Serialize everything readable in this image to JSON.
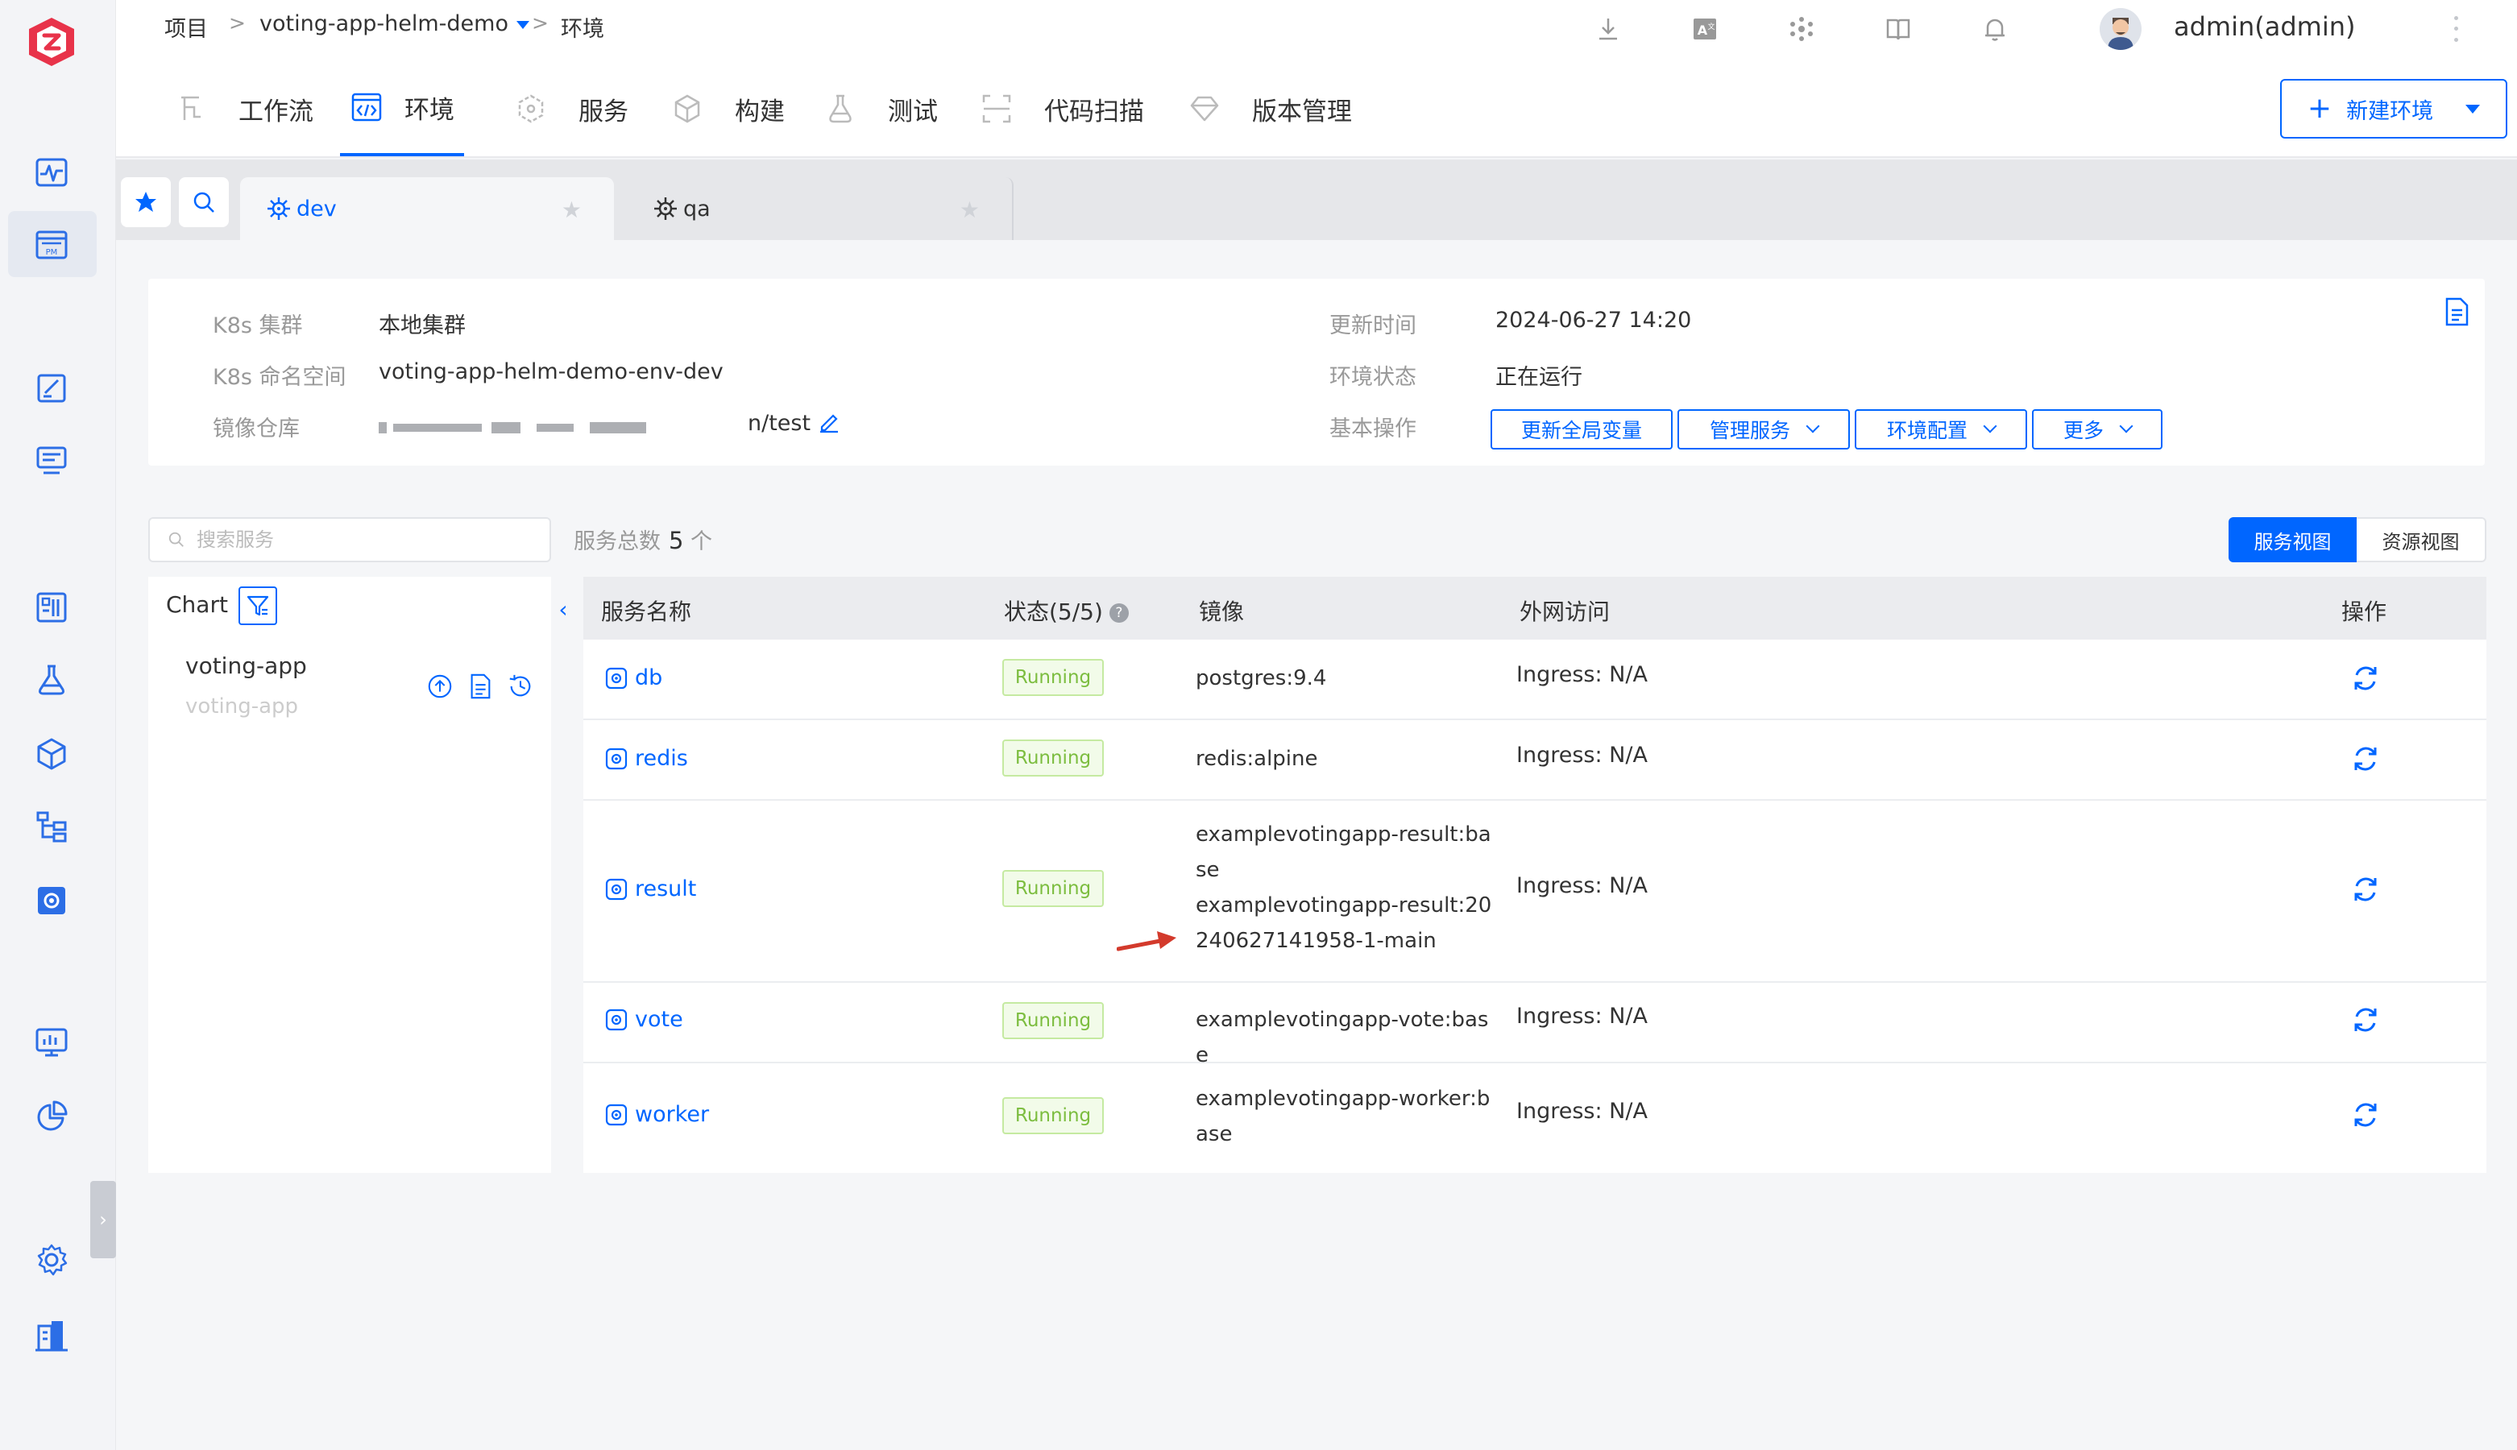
{
  "breadcrumb": {
    "root": "项目",
    "sep1": ">",
    "project": "voting-app-helm-demo",
    "sep2": ">",
    "current": "环境"
  },
  "user": {
    "name": "admin(admin)"
  },
  "modules": [
    {
      "label": "工作流",
      "icon": "workflow-icon"
    },
    {
      "label": "环境",
      "icon": "code-window-icon"
    },
    {
      "label": "服务",
      "icon": "cube-icon"
    },
    {
      "label": "构建",
      "icon": "box-icon"
    },
    {
      "label": "测试",
      "icon": "flask-icon"
    },
    {
      "label": "代码扫描",
      "icon": "scan-icon"
    },
    {
      "label": "版本管理",
      "icon": "diamond-icon"
    }
  ],
  "new_env_button": {
    "plus": "+",
    "label": "新建环境"
  },
  "env_tabs": [
    {
      "label": "dev",
      "active": true
    },
    {
      "label": "qa",
      "active": false
    }
  ],
  "info": {
    "k8s_cluster_label": "K8s 集群",
    "k8s_cluster_value": "本地集群",
    "namespace_label": "K8s 命名空间",
    "namespace_value": "voting-app-helm-demo-env-dev",
    "registry_label": "镜像仓库",
    "registry_value_suffix": "n/test",
    "updated_label": "更新时间",
    "updated_value": "2024-06-27 14:20",
    "status_label": "环境状态",
    "status_value": "正在运行",
    "ops_label": "基本操作",
    "ops": {
      "update_vars": "更新全局变量",
      "manage_services": "管理服务",
      "env_config": "环境配置",
      "more": "更多"
    }
  },
  "search": {
    "placeholder": "搜索服务"
  },
  "service_total": {
    "label": "服务总数",
    "count": "5",
    "unit": "个"
  },
  "view_toggle": {
    "service_view": "服务视图",
    "resource_view": "资源视图"
  },
  "chart_panel": {
    "title": "Chart",
    "item_name": "voting-app",
    "item_sub": "voting-app"
  },
  "table": {
    "headers": {
      "name": "服务名称",
      "status": "状态(5/5)",
      "help": "?",
      "image": "镜像",
      "ingress": "外网访问",
      "actions": "操作"
    },
    "rows": [
      {
        "name": "db",
        "status": "Running",
        "images": [
          "postgres:9.4"
        ],
        "ingress": "Ingress: N/A"
      },
      {
        "name": "redis",
        "status": "Running",
        "images": [
          "redis:alpine"
        ],
        "ingress": "Ingress: N/A"
      },
      {
        "name": "result",
        "status": "Running",
        "images": [
          "examplevotingapp-result:base",
          "examplevotingapp-result:20240627141958-1-main"
        ],
        "ingress": "Ingress: N/A"
      },
      {
        "name": "vote",
        "status": "Running",
        "images": [
          "examplevotingapp-vote:base"
        ],
        "ingress": "Ingress: N/A"
      },
      {
        "name": "worker",
        "status": "Running",
        "images": [
          "examplevotingapp-worker:base"
        ],
        "ingress": "Ingress: N/A"
      }
    ]
  },
  "colors": {
    "accent": "#0066ff",
    "running_text": "#7cbd3f",
    "running_bg": "#f2fbe9",
    "logo": "#e8334a",
    "arrow": "#d33a2c"
  }
}
